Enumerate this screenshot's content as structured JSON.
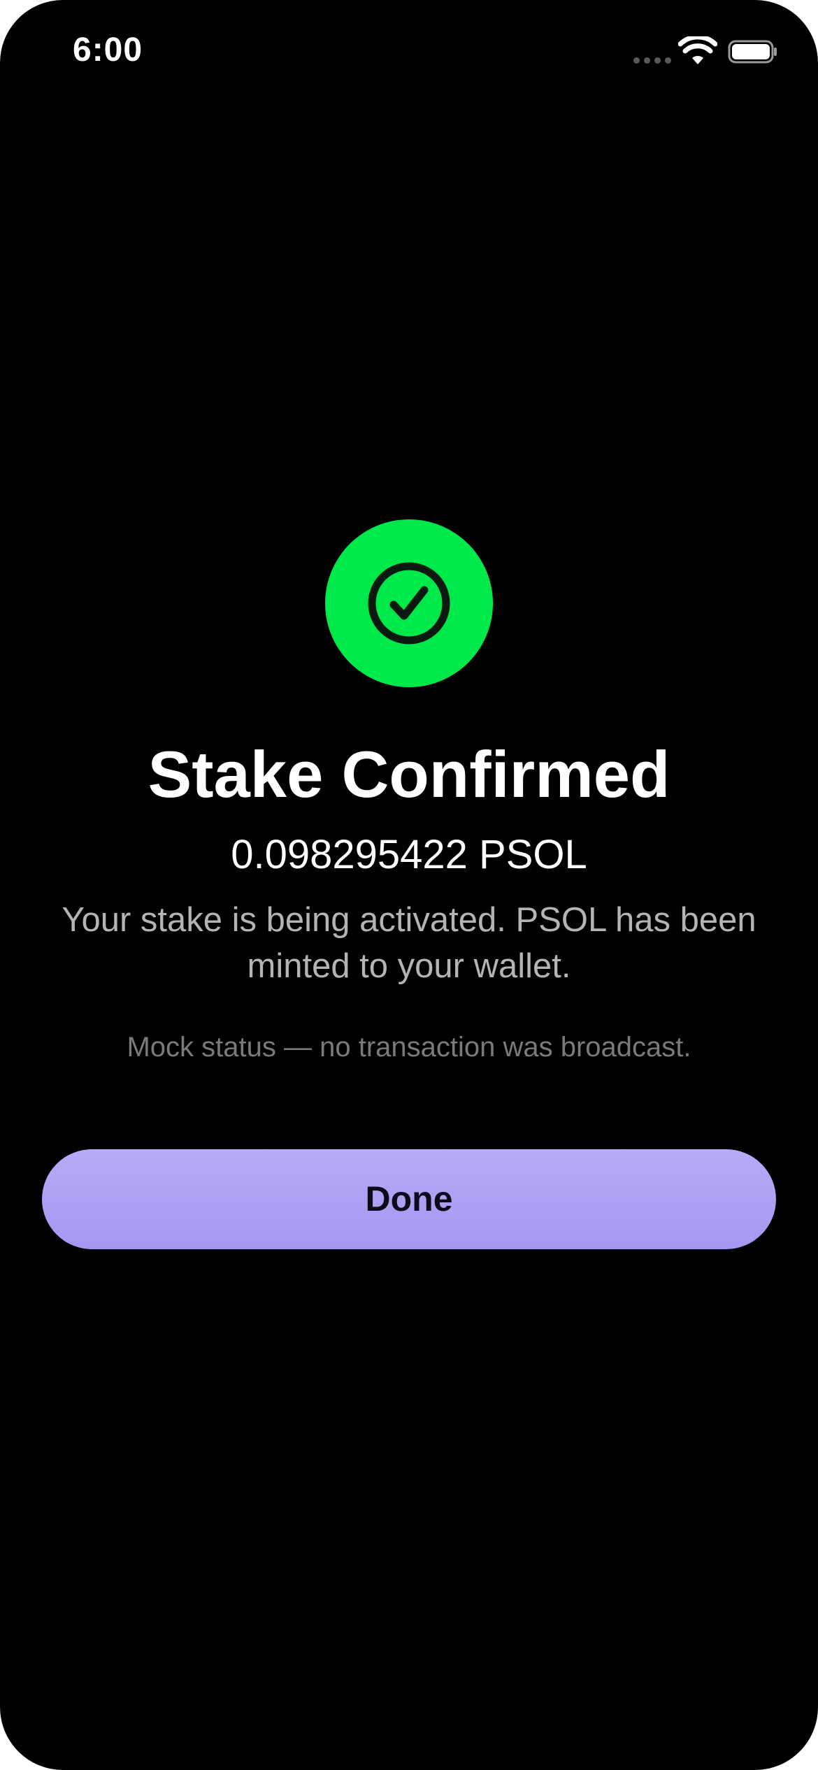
{
  "status_bar": {
    "time": "6:00",
    "icons": [
      "cellular-signal-icon",
      "wifi-icon",
      "battery-icon"
    ]
  },
  "confirmation": {
    "icon": "checkmark-circle-icon",
    "title": "Stake Confirmed",
    "amount": "0.098295422 PSOL",
    "message": "Your stake is being activated. PSOL has been minted to your wallet.",
    "note": "Mock status — no transaction was broadcast."
  },
  "actions": {
    "done_label": "Done"
  },
  "colors": {
    "background": "#000000",
    "success": "#00e94a",
    "button": "#ad9ff5",
    "button_text": "#0d0b1a",
    "secondary_text": "#b4b4b4",
    "muted_text": "#7a7a7a"
  }
}
